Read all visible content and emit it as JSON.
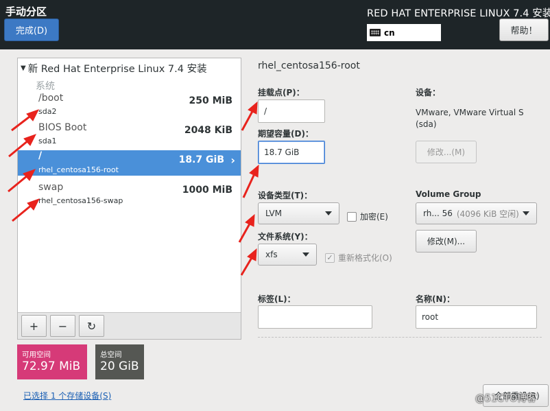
{
  "header": {
    "title": "手动分区",
    "done_label": "完成(D)",
    "product": "RED HAT ENTERPRISE LINUX 7.4 安装",
    "keyboard_layout": "cn",
    "help_label": "帮助！"
  },
  "left_panel": {
    "install_title": "新 Red Hat Enterprise Linux 7.4 安装",
    "section_system": "系统",
    "mounts": [
      {
        "name": "/boot",
        "device": "sda2",
        "size": "250 MiB",
        "selected": false
      },
      {
        "name": "BIOS Boot",
        "device": "sda1",
        "size": "2048 KiB",
        "selected": false
      },
      {
        "name": "/",
        "device": "rhel_centosa156-root",
        "size": "18.7 GiB",
        "selected": true
      },
      {
        "name": "swap",
        "device": "rhel_centosa156-swap",
        "size": "1000 MiB",
        "selected": false
      }
    ],
    "toolbar": {
      "add": "+",
      "remove": "−",
      "refresh": "↻"
    }
  },
  "space": {
    "available_label": "可用空间",
    "available_value": "72.97 MiB",
    "total_label": "总空间",
    "total_value": "20 GiB"
  },
  "storage_link": "已选择 1 个存储设备(S)",
  "details": {
    "title": "rhel_centosa156-root",
    "mount_point_label": "挂载点(P)：",
    "mount_point_value": "/",
    "capacity_label": "期望容量(D)：",
    "capacity_value": "18.7 GiB",
    "device_type_label": "设备类型(T)：",
    "device_type_value": "LVM",
    "encrypt_label": "加密(E)",
    "filesystem_label": "文件系统(Y)：",
    "filesystem_value": "xfs",
    "reformat_label": "重新格式化(O)",
    "devices_label": "设备：",
    "devices_desc": "VMware, VMware Virtual S (sda)",
    "modify_device_label": "修改...(M)",
    "vg_label": "Volume Group",
    "vg_value": "rh... 56",
    "vg_free": "(4096 KiB 空闲)",
    "modify_vg_label": "修改(M)...",
    "tag_label": "标签(L)：",
    "tag_value": "",
    "name_label": "名称(N)：",
    "name_value": "root",
    "reset_label": "全部重设(R)"
  },
  "watermark": "@51CTO博客",
  "colors": {
    "topbar": "#1e2528",
    "accent": "#3c79c4",
    "selected_row": "#4a90d9",
    "available_space": "#d63a78",
    "total_space": "#555753",
    "annotation_arrow": "#e8231d"
  }
}
